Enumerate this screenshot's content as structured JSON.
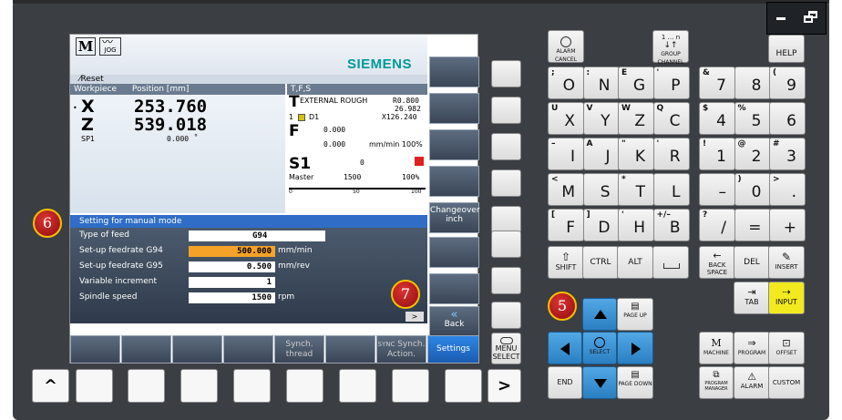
{
  "screen": {
    "mode_icon_m": "M",
    "mode_icon_jog": "JOG",
    "brand": "SIEMENS",
    "reset": "Reset",
    "header_workpiece": "Workpiece",
    "header_position": "Position [mm]",
    "header_tfs": "T,F,S",
    "axes": [
      {
        "name": "X",
        "value": "253.760"
      },
      {
        "name": "Z",
        "value": "539.018"
      }
    ],
    "spindle_label": "SP1",
    "spindle_value": "0.000",
    "spindle_unit": "°",
    "tool_letter": "T",
    "tool_name": "EXTERNAL ROUGH",
    "tool_r": "R0.800",
    "tool_val2": "26.982",
    "tool_val3": "X126.240",
    "tool_num": "1",
    "tool_d": "D1",
    "feed_letter": "F",
    "feed_val1": "0.000",
    "feed_val2": "0.000",
    "feed_unit": "mm/min 100%",
    "s_label": "S1",
    "s_value": "0",
    "master": "Master",
    "master_val": "1500",
    "master_pct": "100%",
    "scale_0": "0",
    "scale_50": "50",
    "scale_100": "100",
    "setting_title": "Setting for manual mode",
    "rows": [
      {
        "label": "Type of feed",
        "value": "G94",
        "unit": ""
      },
      {
        "label": "Set-up feedrate G94",
        "value": "500.000",
        "unit": "mm/min"
      },
      {
        "label": "Set-up feedrate G95",
        "value": "0.500",
        "unit": "mm/rev"
      },
      {
        "label": "Variable increment",
        "value": "1",
        "unit": ""
      },
      {
        "label": "Spindle speed",
        "value": "1500",
        "unit": "rpm"
      }
    ],
    "vsk_changeover": "Changeover inch",
    "vsk_back": "Back",
    "back_arrows": "«",
    "hsk_synch_thread": "Synch. thread",
    "hsk_synch_action": "Synch. Action.",
    "hsk_sync_prefix": "SYNC",
    "hsk_settings": "Settings",
    "more_arrow": ">"
  },
  "badges": {
    "six": "6",
    "seven": "7",
    "five": "5"
  },
  "keys": {
    "alarm_cancel": "ALARM CANCEL",
    "group_channel": "GROUP CHANNEL",
    "group_top": "1 … n",
    "help": "HELP",
    "menu_select": "MENU SELECT",
    "shift": "SHIFT",
    "ctrl": "CTRL",
    "alt": "ALT",
    "back_space": "BACK SPACE",
    "del": "DEL",
    "insert": "INSERT",
    "tab": "TAB",
    "input": "INPUT",
    "page_up": "PAGE UP",
    "page_down": "PAGE DOWN",
    "select": "SELECT",
    "end": "END",
    "machine": "MACHINE",
    "program": "PROGRAM",
    "offset": "OFFSET",
    "program_manager": "PROGRAM MANAGER",
    "alarm": "ALARM",
    "custom": "CUSTOM",
    "caret": "^",
    "gt": ">"
  },
  "alpha_rows": [
    [
      {
        "s": ";",
        "m": "O"
      },
      {
        "s": ":",
        "m": "N"
      },
      {
        "s": "E",
        "m": "G"
      },
      {
        "s": "'",
        "m": "P"
      }
    ],
    [
      {
        "s": "U",
        "m": "X"
      },
      {
        "s": "V",
        "m": "Y"
      },
      {
        "s": "W",
        "m": "Z"
      },
      {
        "s": "Q",
        "m": "C"
      }
    ],
    [
      {
        "s": "–",
        "m": "I"
      },
      {
        "s": "A",
        "m": "J"
      },
      {
        "s": "\"",
        "m": "K"
      },
      {
        "s": "'",
        "m": "R"
      }
    ],
    [
      {
        "s": "<",
        "m": "M"
      },
      {
        "s": "",
        "m": "S"
      },
      {
        "s": "*",
        "m": "T"
      },
      {
        "s": "",
        "m": "L"
      }
    ],
    [
      {
        "s": "[",
        "m": "F"
      },
      {
        "s": "]",
        "m": "D"
      },
      {
        "s": "'",
        "m": "H"
      },
      {
        "s": "+/–",
        "m": "B"
      }
    ]
  ],
  "num_rows": [
    [
      {
        "s": "&",
        "m": "7"
      },
      {
        "s": "",
        "m": "8"
      },
      {
        "s": "(",
        "m": "9"
      }
    ],
    [
      {
        "s": "$",
        "m": "4"
      },
      {
        "s": "%",
        "m": "5"
      },
      {
        "s": "",
        "m": "6"
      }
    ],
    [
      {
        "s": "!",
        "m": "1"
      },
      {
        "s": "@",
        "m": "2"
      },
      {
        "s": "#",
        "m": "3"
      }
    ],
    [
      {
        "s": "",
        "m": "–"
      },
      {
        "s": ")",
        "m": "0"
      },
      {
        "s": ">",
        "m": "."
      }
    ],
    [
      {
        "s": "?",
        "m": "/"
      },
      {
        "s": "",
        "m": "="
      },
      {
        "s": "",
        "m": "+"
      }
    ]
  ]
}
